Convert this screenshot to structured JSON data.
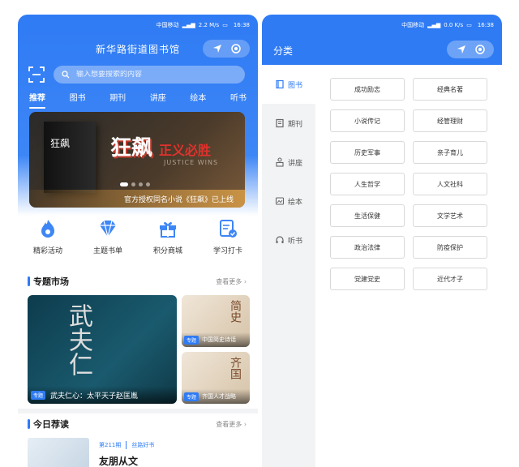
{
  "status": {
    "carrier": "中国移动",
    "time": "16:38",
    "speed_left": "2.2 M/s",
    "speed_right": "0.0 K/s"
  },
  "left": {
    "app_title": "新华路街道图书馆",
    "search_placeholder": "输入想要搜索的内容",
    "tabs": [
      "推荐",
      "图书",
      "期刊",
      "讲座",
      "绘本",
      "听书"
    ],
    "active_tab": "推荐",
    "banner": {
      "book_title": "狂飙",
      "headline": "狂飙",
      "red_text": "正义必胜",
      "sub_text": "JUSTICE WINS",
      "caption": "官方授权同名小说《狂飙》已上线"
    },
    "quick_links": [
      "精彩活动",
      "主题书单",
      "积分商城",
      "学习打卡"
    ],
    "section_topic": {
      "title": "专题市场",
      "more": "查看更多"
    },
    "topics": {
      "big": {
        "tag": "专题",
        "caption": "武夫仁心：太平天子赵匡胤",
        "art": "武夫仁"
      },
      "small1": {
        "tag": "专题",
        "caption": "中国简史诗话",
        "art": "简史"
      },
      "small2": {
        "tag": "专题",
        "caption": "齐国人才战略",
        "art": "齐国"
      }
    },
    "section_daily": {
      "title": "今日荐读",
      "more": "查看更多"
    },
    "daily": {
      "issue": "第211期",
      "column": "丝路好书",
      "name": "友朋从文"
    }
  },
  "right": {
    "title": "分类",
    "sidebar": [
      "图书",
      "期刊",
      "讲座",
      "绘本",
      "听书"
    ],
    "active_sidebar": "图书",
    "categories": [
      "成功励志",
      "经典名著",
      "小说传记",
      "经管理财",
      "历史军事",
      "亲子育儿",
      "人生哲学",
      "人文社科",
      "生活保健",
      "文学艺术",
      "政治法律",
      "防疫保护",
      "党建党史",
      "近代才子"
    ]
  },
  "colors": {
    "brand_blue": "#2f7bf4"
  }
}
